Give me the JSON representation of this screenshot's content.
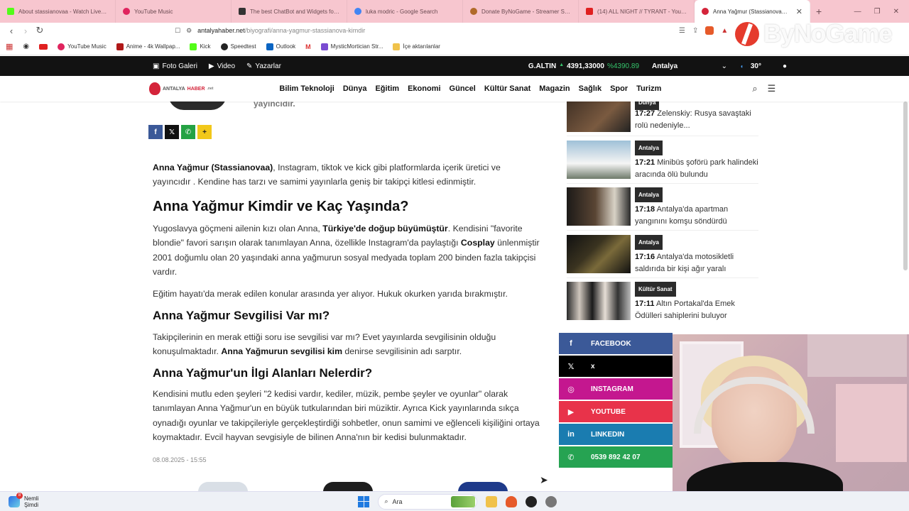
{
  "browser": {
    "tabs": [
      {
        "title": "About stassianovaa - Watch Live on",
        "color": "#53fc18"
      },
      {
        "title": "YouTube Music",
        "color": "#e0245e"
      },
      {
        "title": "The best ChatBot and Widgets for K",
        "color": "#333333"
      },
      {
        "title": "luka modric - Google Search",
        "color": "#4285f4"
      },
      {
        "title": "Donate ByNoGame - Streamer Setti",
        "color": "#b06a2a"
      },
      {
        "title": "(14) ALL NIGHT // TYRANT - YouTub",
        "color": "#e02020"
      },
      {
        "title": "Anna Yağmur (Stassianova) kim",
        "color": "#d4243a",
        "active": true
      }
    ],
    "url_host": "antalyahaber.net",
    "url_path": "/biyografi/anna-yagmur-stassianova-kimdir",
    "bookmarks": [
      "YouTube Music",
      "Anime - 4k Wallpap...",
      "Kick",
      "Speedtest",
      "Outlook",
      "MysticMortician Str...",
      "İçe aktarılanlar"
    ]
  },
  "overlay": {
    "brand": "ByNoGame"
  },
  "topbar": {
    "photo_gallery": "Foto Galeri",
    "video": "Video",
    "writers": "Yazarlar",
    "gold_label": "G.ALTIN",
    "gold_value": "4391,33000",
    "gold_change": "%4390.89",
    "city": "Antalya",
    "temperature": "30°"
  },
  "nav": {
    "logo_parts": [
      "ANTALYA",
      "HABER",
      ".net"
    ],
    "menu": [
      "Bilim Teknoloji",
      "Dünya",
      "Eğitim",
      "Ekonomi",
      "Güncel",
      "Kültür Sanat",
      "Magazin",
      "Sağlık",
      "Spor",
      "Turizm"
    ]
  },
  "article": {
    "author_role": "yayıncıdır.",
    "intro_bold": "Anna Yağmur (Stassianovaa)",
    "intro_rest": ", Instagram, tiktok ve kick gibi platformlarda içerik üretici ve yayıncıdır . Kendine has tarzı ve samimi yayınlarla geniş bir takipçi kitlesi edinmiştir.",
    "h2": "Anna Yağmur Kimdir ve Kaç Yaşında?",
    "p2_a": "Yugoslavya göçmeni ailenin kızı olan Anna, ",
    "p2_b": "Türkiye'de doğup büyümüştür",
    "p2_c": ". Kendisini \"favorite blondie\" favori sarışın olarak tanımlayan Anna, özellikle Instagram'da paylaştığı ",
    "p2_d": "Cosplay",
    "p2_e": " ünlenmiştir 2001 doğumlu olan 20 yaşındaki anna yağmurun sosyal medyada toplam 200 binden fazla takipçisi vardır.",
    "p3": "Eğitim hayatı'da merak edilen konular arasında yer alıyor. Hukuk okurken yarıda bırakmıştır.",
    "h3a": "Anna Yağmur Sevgilisi Var mı?",
    "p4_a": "Takipçilerinin en merak ettiği soru ise sevgilisi var mı? Evet yayınlarda sevgilisinin olduğu konuşulmaktadır. ",
    "p4_b": "Anna Yağmurun sevgilisi kim",
    "p4_c": " denirse sevgilisinin adı sarptır.",
    "h3b": "Anna Yağmur'un İlgi Alanları Nelerdir?",
    "p5": "Kendisini mutlu eden şeyleri \"2 kedisi vardır, kediler, müzik, pembe şeyler ve oyunlar\" olarak tanımlayan Anna Yağmur'un en büyük tutkularından biri müziktir. Ayrıca Kick yayınlarında sıkça oynadığı oyunlar ve takipçileriyle gerçekleştirdiği sohbetler, onun samimi ve eğlenceli kişiliğini ortaya koymaktadır. Evcil hayvan sevgisiyle de bilinen Anna'nın bir kedisi bulunmaktadır.",
    "date": "08.08.2025 - 15:55"
  },
  "sidebar": {
    "top_partial": {
      "category": "Dünya",
      "time": "17:27",
      "title": "Zelenskiy: Rusya savaştaki rolü nedeniyle..."
    },
    "news": [
      {
        "category": "Antalya",
        "time": "17:21",
        "title": "Minibüs şoförü park halindeki aracında ölü bulundu"
      },
      {
        "category": "Antalya",
        "time": "17:18",
        "title": "Antalya'da apartman yangınını komşu söndürdü"
      },
      {
        "category": "Antalya",
        "time": "17:16",
        "title": "Antalya'da motosikletli saldırıda bir kişi ağır yaralı"
      },
      {
        "category": "Kültür Sanat",
        "time": "17:11",
        "title": "Altın Portakal'da Emek Ödülleri sahiplerini buluyor"
      }
    ],
    "social": [
      {
        "label": "FACEBOOK",
        "color": "#3b5998",
        "icon": "f"
      },
      {
        "label": "x",
        "color": "#000000",
        "icon": "𝕏"
      },
      {
        "label": "INSTAGRAM",
        "color": "#c4178f",
        "icon": "◎"
      },
      {
        "label": "YOUTUBE",
        "color": "#e8334a",
        "icon": "▶"
      },
      {
        "label": "LINKEDIN",
        "color": "#1a7cb0",
        "icon": "in"
      },
      {
        "label": "0539 892 42 07",
        "color": "#26a352",
        "icon": "✆"
      }
    ]
  },
  "taskbar": {
    "notif_count": "8",
    "notif_title": "Nemli",
    "notif_sub": "Şimdi",
    "search_label": "Ara"
  }
}
